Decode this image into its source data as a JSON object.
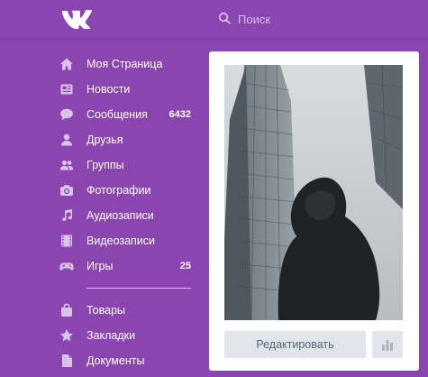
{
  "header": {
    "search_placeholder": "Поиск"
  },
  "sidebar": {
    "items": [
      {
        "icon": "home-icon",
        "label": "Моя Страница",
        "count": ""
      },
      {
        "icon": "news-icon",
        "label": "Новости",
        "count": ""
      },
      {
        "icon": "messages-icon",
        "label": "Сообщения",
        "count": "6432"
      },
      {
        "icon": "friends-icon",
        "label": "Друзья",
        "count": ""
      },
      {
        "icon": "groups-icon",
        "label": "Группы",
        "count": ""
      },
      {
        "icon": "camera-icon",
        "label": "Фотографии",
        "count": ""
      },
      {
        "icon": "music-note-icon",
        "label": "Аудиозаписи",
        "count": ""
      },
      {
        "icon": "film-icon",
        "label": "Видеозаписи",
        "count": ""
      },
      {
        "icon": "gamepad-icon",
        "label": "Игры",
        "count": "25"
      }
    ],
    "extra_items": [
      {
        "icon": "bag-icon",
        "label": "Товары"
      },
      {
        "icon": "star-icon",
        "label": "Закладки"
      },
      {
        "icon": "document-icon",
        "label": "Документы"
      }
    ]
  },
  "profile_card": {
    "edit_label": "Редактировать",
    "stats_icon": "bar-chart-icon"
  },
  "colors": {
    "background": "#8a45b0",
    "card": "#ffffff",
    "button": "#e1e5eb",
    "button_text": "#55677d",
    "sidebar_icon": "#d8c4e6"
  }
}
